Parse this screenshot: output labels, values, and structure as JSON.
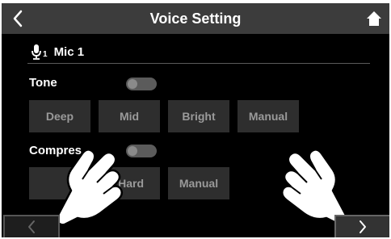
{
  "header": {
    "title": "Voice Setting",
    "back_icon": "chevron-left-icon",
    "home_icon": "home-icon"
  },
  "mic": {
    "number": "1",
    "label": "Mic 1",
    "icon": "microphone-icon"
  },
  "tone": {
    "label": "Tone",
    "toggle_on": false,
    "options": [
      "Deep",
      "Mid",
      "Bright",
      "Manual"
    ]
  },
  "compressor": {
    "label_visible": "Compres",
    "toggle_on": false,
    "options": [
      "Hard",
      "Manual"
    ]
  },
  "footer": {
    "prev_icon": "chevron-left-icon",
    "next_icon": "chevron-right-icon"
  },
  "overlay": {
    "left_hand_icon": "pointing-hand-icon",
    "right_hand_icon": "pointing-hand-icon"
  },
  "colors": {
    "background": "#000000",
    "title_bar": "#3c3c3c",
    "button_bg": "#2e2e2e",
    "button_text": "#9a9a9a",
    "toggle_off": "#5b5b5b"
  }
}
